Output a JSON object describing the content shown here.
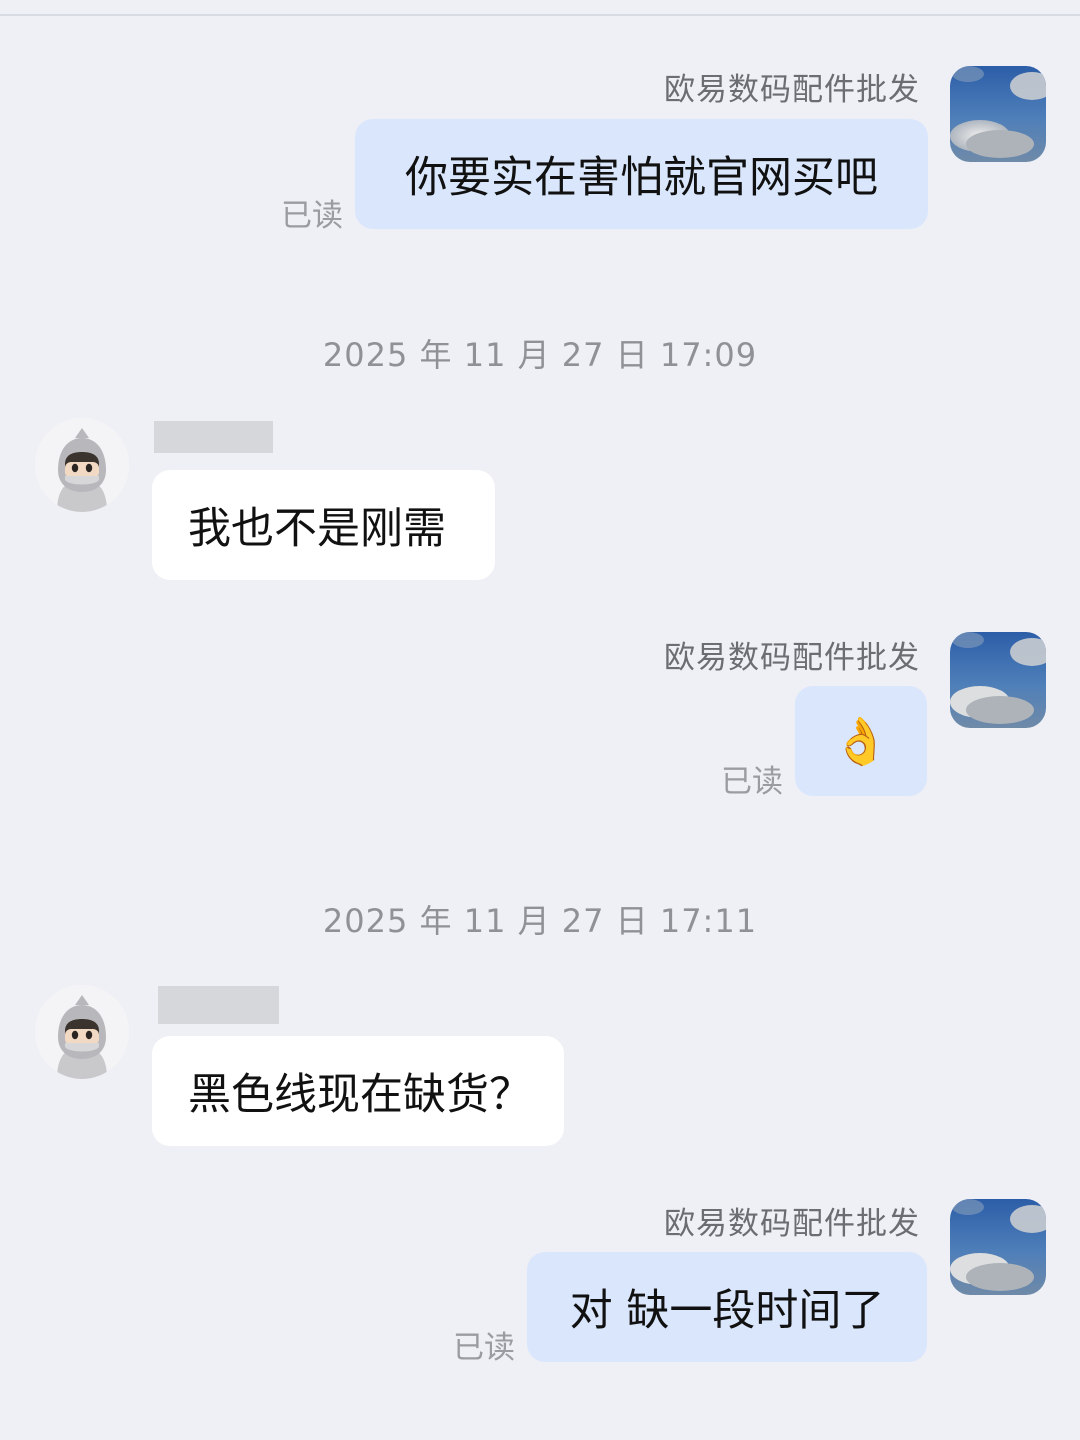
{
  "messages": [
    {
      "sender": "欧易数码配件批发",
      "text": "你要实在害怕就官网买吧",
      "status": "已读"
    },
    {
      "timestamp": "2025 年 11 月 27 日 17:09"
    },
    {
      "text": "我也不是刚需"
    },
    {
      "sender": "欧易数码配件批发",
      "text": "👌",
      "status": "已读"
    },
    {
      "timestamp": "2025 年 11 月 27 日 17:11"
    },
    {
      "text": "黑色线现在缺货？"
    },
    {
      "sender": "欧易数码配件批发",
      "text": "对 缺一段时间了",
      "status": "已读"
    }
  ],
  "colors": {
    "background": "#eff0f5",
    "sent_bubble": "#d9e6fc",
    "received_bubble": "#ffffff",
    "read_text": "#9a9ca2",
    "sender_name": "#6b6d73",
    "timestamp": "#8f9197"
  }
}
